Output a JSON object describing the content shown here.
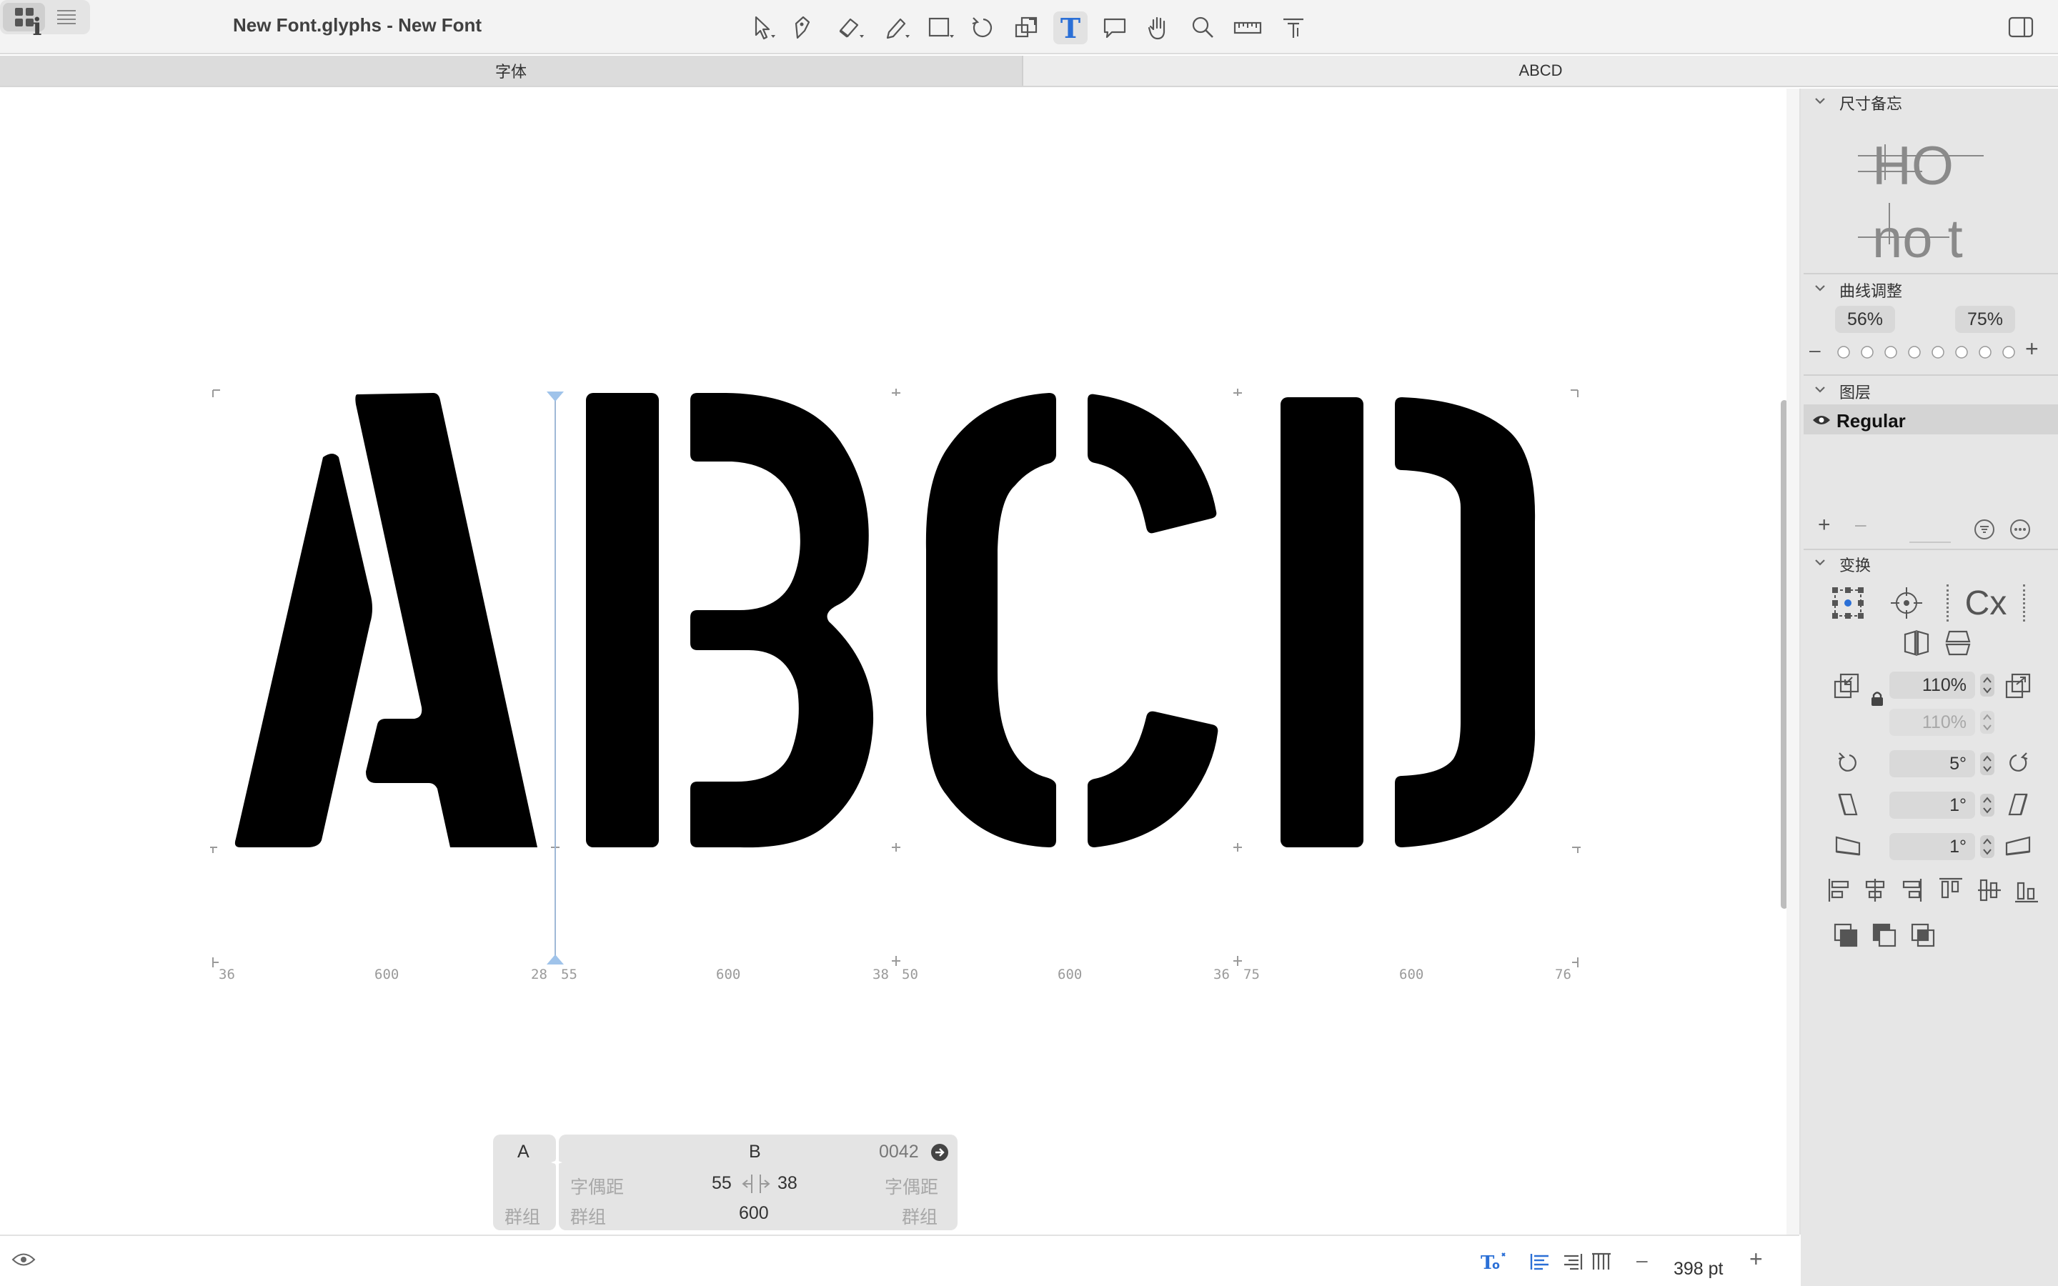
{
  "window": {
    "title": "New Font.glyphs - New Font"
  },
  "tabs": [
    {
      "label": "字体"
    },
    {
      "label": "ABCD"
    }
  ],
  "toolbar": {
    "tools": [
      {
        "name": "select-tool-icon"
      },
      {
        "name": "pen-tool-icon"
      },
      {
        "name": "eraser-tool-icon"
      },
      {
        "name": "pencil-tool-icon"
      },
      {
        "name": "rectangle-tool-icon"
      },
      {
        "name": "rotate-tool-icon"
      },
      {
        "name": "scale-tool-icon"
      },
      {
        "name": "text-tool-icon",
        "active": true
      },
      {
        "name": "annotation-tool-icon"
      },
      {
        "name": "hand-tool-icon"
      },
      {
        "name": "zoom-tool-icon"
      },
      {
        "name": "measure-tool-icon"
      },
      {
        "name": "vertical-text-tool-icon"
      }
    ],
    "text_tool_glyph": "T"
  },
  "canvas": {
    "glyphs": [
      {
        "name": "A",
        "lsb": "36",
        "width": "600",
        "rsb": "28"
      },
      {
        "name": "B",
        "lsb": "55",
        "width": "600",
        "rsb": "38"
      },
      {
        "name": "C",
        "lsb": "50",
        "width": "600",
        "rsb": "36"
      },
      {
        "name": "D",
        "lsb": "75",
        "width": "600",
        "rsb": "76"
      }
    ]
  },
  "glyph_info": {
    "left_glyph": "A",
    "current_glyph": "B",
    "unicode": "0042",
    "left_kerning_label": "字偶距",
    "right_kerning_label": "字偶距",
    "left_group_label": "群组",
    "right_group_label": "群组",
    "left_group_label_a": "群组",
    "lsb": "55",
    "rsb": "38",
    "width": "600"
  },
  "bottom_bar": {
    "zoom": "398 pt",
    "zoom_minus": "–",
    "zoom_plus": "+"
  },
  "panel": {
    "dimensions": {
      "title": "尺寸备忘",
      "preview_top": "HO",
      "preview_bottom": "no t"
    },
    "curve": {
      "title": "曲线调整",
      "value1": "56%",
      "value2": "75%",
      "minus": "–",
      "plus": "+"
    },
    "layers": {
      "title": "图层",
      "items": [
        {
          "name": "Regular"
        }
      ],
      "add": "+",
      "remove": "–"
    },
    "transform": {
      "title": "变换",
      "cx_label": "Cx",
      "scale_x": "110%",
      "scale_y": "110%",
      "rotate": "5°",
      "slant_x": "1°",
      "slant_y": "1°"
    }
  }
}
